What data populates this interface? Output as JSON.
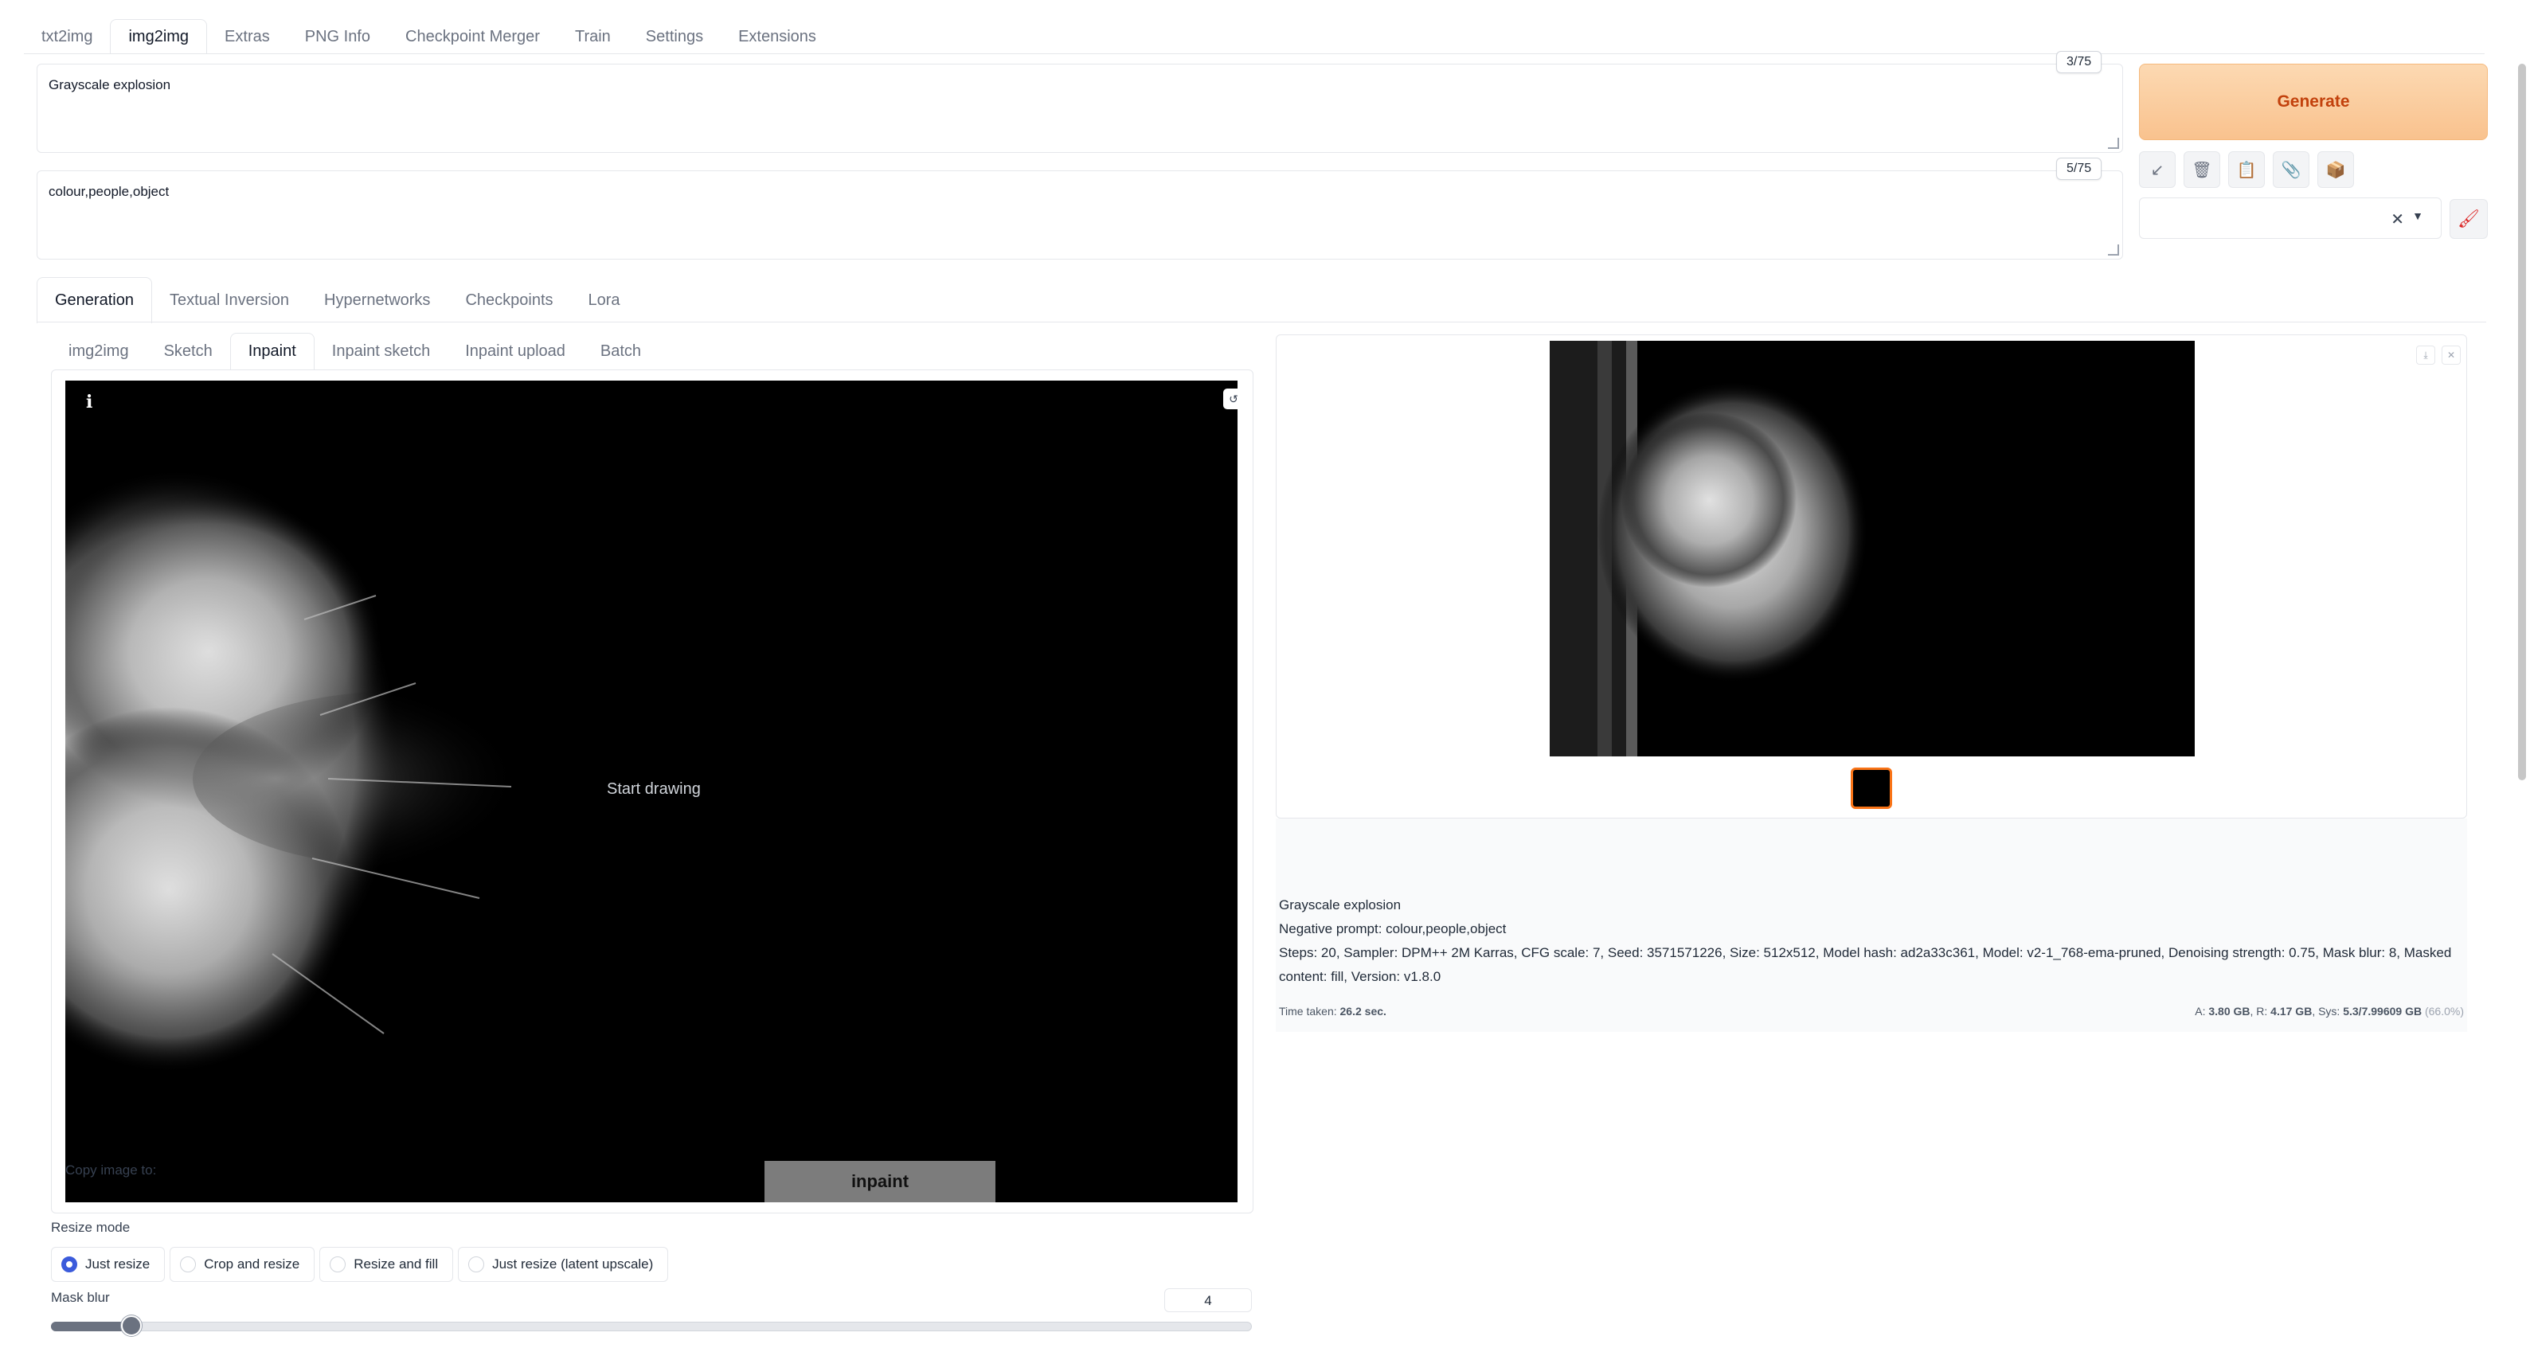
{
  "top_tabs": [
    "txt2img",
    "img2img",
    "Extras",
    "PNG Info",
    "Checkpoint Merger",
    "Train",
    "Settings",
    "Extensions"
  ],
  "prompt": {
    "text": "Grayscale explosion",
    "token_count": "3/75"
  },
  "negative_prompt": {
    "text": "colour,people,object",
    "token_count": "5/75"
  },
  "generate_label": "Generate",
  "tool_icons": [
    "arrow-icon",
    "trash-icon",
    "clipboard-icon",
    "paperclip-icon",
    "box-icon"
  ],
  "gen_tabs": [
    "Generation",
    "Textual Inversion",
    "Hypernetworks",
    "Checkpoints",
    "Lora"
  ],
  "sub_tabs": [
    "img2img",
    "Sketch",
    "Inpaint",
    "Inpaint sketch",
    "Inpaint upload",
    "Batch"
  ],
  "canvas": {
    "info_mark": "i",
    "start_drawing": "Start drawing",
    "copy_image_to": "Copy image to:",
    "inpaint_button": "inpaint"
  },
  "resize_mode": {
    "label": "Resize mode",
    "options": [
      "Just resize",
      "Crop and resize",
      "Resize and fill",
      "Just resize (latent upscale)"
    ],
    "selected": "Just resize"
  },
  "mask_blur": {
    "label": "Mask blur",
    "value": "4",
    "fraction": 0.067
  },
  "output": {
    "prompt": "Grayscale explosion",
    "negative": "Negative prompt: colour,people,object",
    "params_line1": "Steps: 20, Sampler: DPM++ 2M Karras, CFG scale: 7, Seed: 3571571226, Size: 512x512, Model hash: ad2a33c361, Model: v2-1_768-ema-pruned, Denoising strength: 0.75, Mask blur: 8, Masked",
    "params_line2": "content: fill, Version: v1.8.0",
    "time_label": "Time taken:",
    "time_value": "26.2 sec.",
    "mem_a_label": "A:",
    "mem_a": "3.80 GB",
    "mem_r_label": "R:",
    "mem_r": "4.17 GB",
    "mem_sys_label": "Sys:",
    "mem_sys": "5.3/7.99609 GB",
    "mem_pct": "(66.0%)"
  },
  "colors": {
    "accent": "#f97316",
    "generate_bg": "#fcd9b2",
    "radio_on": "#3b5bdb"
  }
}
